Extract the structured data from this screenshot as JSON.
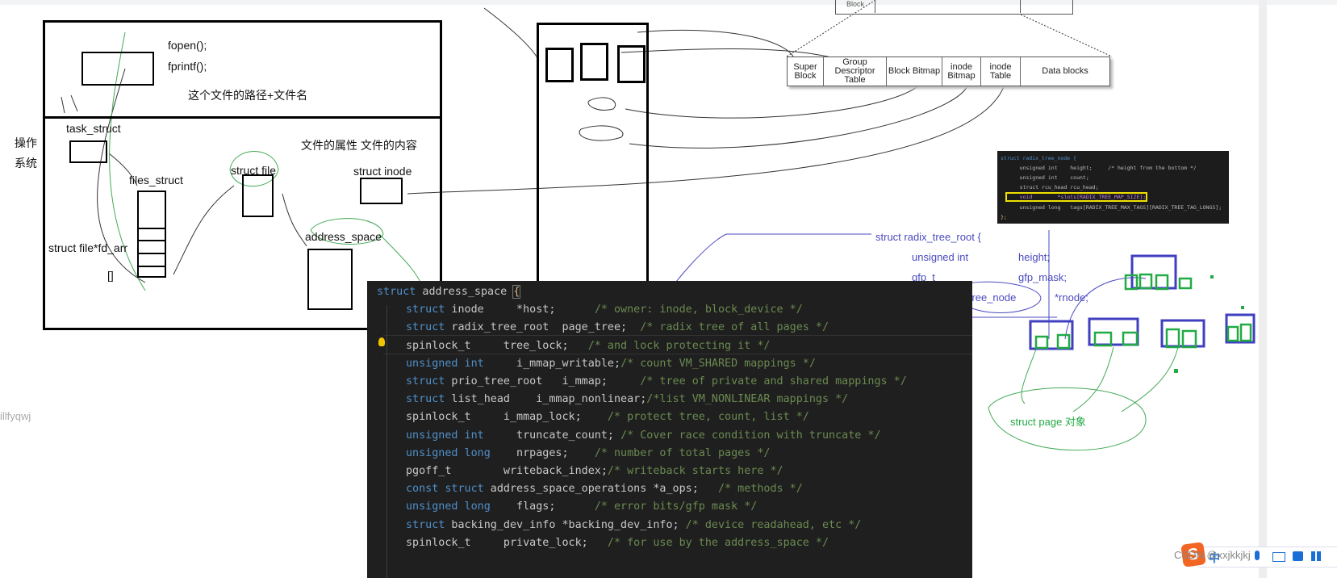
{
  "left_diagram": {
    "fopen": "fopen();",
    "fprintf": "fprintf();",
    "path_note": "这个文件的路径+文件名",
    "os_label": [
      "操作",
      "系统"
    ],
    "task_struct": "task_struct",
    "files_struct": "files_struct",
    "fd_arr": "struct file*fd_arr",
    "brackets": "[]",
    "struct_file": "struct file",
    "attr_note": "文件的属性 文件的内容",
    "struct_inode": "struct inode",
    "address_space": "address_space",
    "side_text": "illfyqwj"
  },
  "disk_layout": {
    "cells": [
      "Super Block",
      "Group Descriptor Table",
      "Block Bitmap",
      "inode Bitmap",
      "inode Table",
      "Data blocks"
    ],
    "top_cell": "Block"
  },
  "code": {
    "lines": [
      {
        "k": "struct",
        "t": " address_space ",
        "b": "{",
        "c": ""
      },
      {
        "k": "struct",
        "t": " inode     *host;      ",
        "c": "/* owner: inode, block_device */"
      },
      {
        "k": "struct",
        "t": " radix_tree_root  page_tree;  ",
        "c": "/* radix tree of all pages */"
      },
      {
        "k": "",
        "t": "spinlock_t     tree_lock;   ",
        "c": "/* and lock protecting it */"
      },
      {
        "k": "unsigned int",
        "t": "     i_mmap_writable;",
        "c": "/* count VM_SHARED mappings */"
      },
      {
        "k": "struct",
        "t": " prio_tree_root   i_mmap;     ",
        "c": "/* tree of private and shared mappings */"
      },
      {
        "k": "struct",
        "t": " list_head    i_mmap_nonlinear;",
        "c": "/*list VM_NONLINEAR mappings */"
      },
      {
        "k": "",
        "t": "spinlock_t     i_mmap_lock;    ",
        "c": "/* protect tree, count, list */"
      },
      {
        "k": "unsigned int",
        "t": "     truncate_count; ",
        "c": "/* Cover race condition with truncate */"
      },
      {
        "k": "unsigned long",
        "t": "    nrpages;    ",
        "c": "/* number of total pages */"
      },
      {
        "k": "",
        "t": "pgoff_t        writeback_index;",
        "c": "/* writeback starts here */"
      },
      {
        "k": "const struct",
        "t": " address_space_operations *a_ops;   ",
        "c": "/* methods */"
      },
      {
        "k": "unsigned long",
        "t": "    flags;      ",
        "c": "/* error bits/gfp mask */"
      },
      {
        "k": "struct",
        "t": " backing_dev_info *backing_dev_info; ",
        "c": "/* device readahead, etc */"
      },
      {
        "k": "",
        "t": "spinlock_t     private_lock;   ",
        "c": "/* for use by the address_space */"
      }
    ]
  },
  "radix_node_code": {
    "lines": [
      "struct radix_tree_node {",
      "    unsigned int    height;     /* height from the bottom */",
      "    unsigned int    count;",
      "    struct rcu_head rcu_head;",
      "    void        *slots[RADIX_TREE_MAP_SIZE];",
      "    unsigned long   tags[RADIX_TREE_MAX_TAGS][RADIX_TREE_TAG_LONGS];",
      "};"
    ]
  },
  "radix_root": {
    "title": "struct radix_tree_root {",
    "fields": [
      {
        "type": "unsigned int",
        "name": "height;"
      },
      {
        "type": "gfp_t",
        "name": "gfp_mask;"
      },
      {
        "type": "struct radix_tree_node",
        "name": "*rnode;"
      }
    ],
    "page_note": "struct page 对象"
  },
  "footer": {
    "watermark": "CSDN @xxjkkjkj",
    "ime_lang": "中"
  },
  "colors": {
    "tree_node": "#3f3fc0",
    "slot": "#22aa44",
    "keyword": "#4f8fc9",
    "comment": "#6a8a50",
    "highlight": "#f0e000"
  }
}
